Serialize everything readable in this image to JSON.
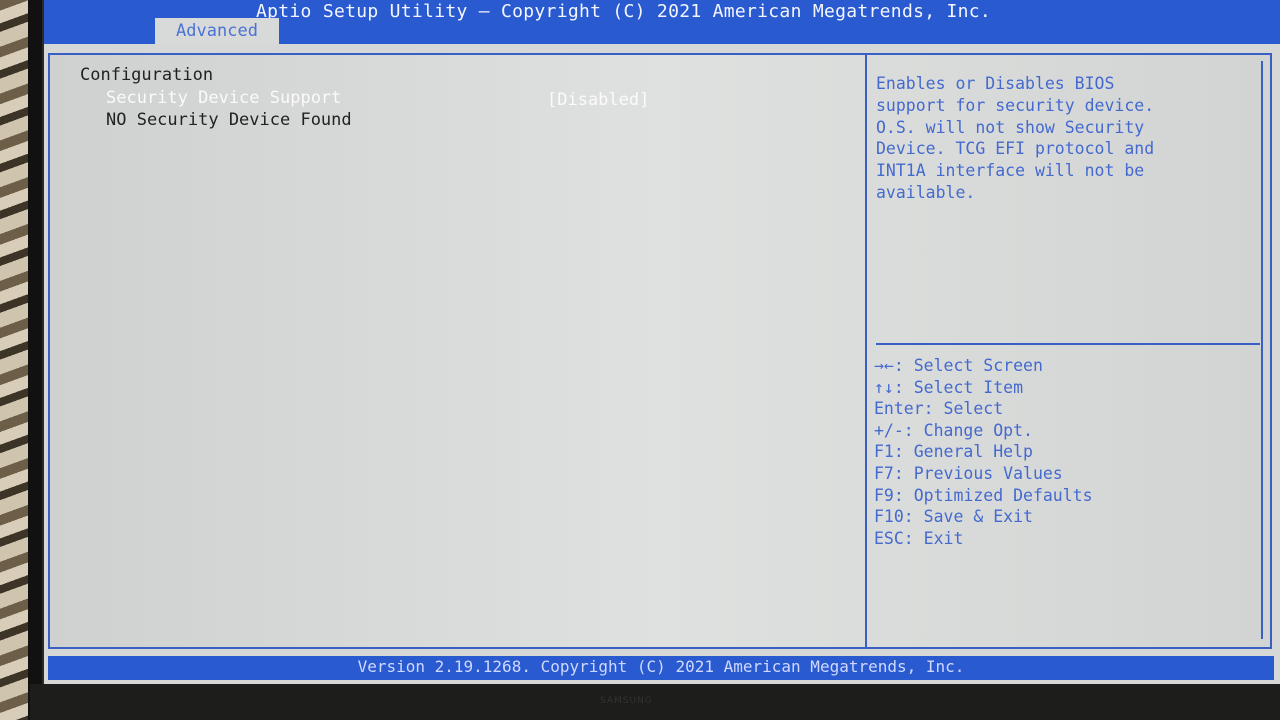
{
  "header": {
    "app_title": "Aptio Setup Utility – Copyright (C) 2021 American Megatrends, Inc.",
    "tabs": [
      {
        "label": "Advanced",
        "active": true
      }
    ]
  },
  "main": {
    "section_title": "Configuration",
    "items": [
      {
        "label": "Security Device Support",
        "value": "[Disabled]",
        "selected": true
      },
      {
        "label": "NO Security Device Found",
        "value": ""
      }
    ]
  },
  "help": {
    "lines": [
      "Enables or Disables BIOS",
      "support for security device.",
      "O.S. will not show Security",
      "Device. TCG EFI protocol and",
      "INT1A interface will not be",
      "available."
    ]
  },
  "keys": [
    "→←: Select Screen",
    "↑↓: Select Item",
    "Enter: Select",
    "+/-: Change Opt.",
    "F1: General Help",
    "F7: Previous Values",
    "F9: Optimized Defaults",
    "F10: Save & Exit",
    "ESC: Exit"
  ],
  "footer": {
    "text": "Version 2.19.1268. Copyright (C) 2021 American Megatrends, Inc."
  },
  "monitor": {
    "brand": "SAMSUNG"
  },
  "colors": {
    "accent_blue": "#2a5ad0",
    "help_text": "#4469cf",
    "panel_bg": "#d6d8d8"
  }
}
